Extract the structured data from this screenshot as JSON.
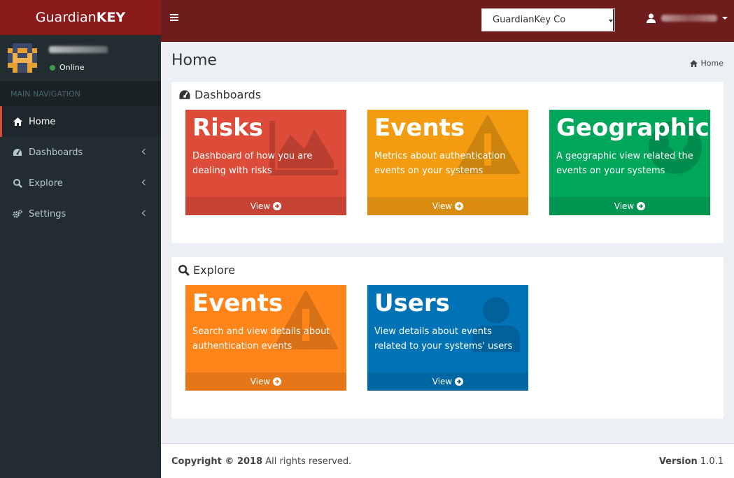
{
  "brand": {
    "light": "Guardian",
    "bold": "KEY"
  },
  "navbar": {
    "company": "GuardianKey Co"
  },
  "sidebar": {
    "status": "Online",
    "nav_header": "MAIN NAVIGATION",
    "items": [
      {
        "label": "Home",
        "icon": "home-icon"
      },
      {
        "label": "Dashboards",
        "icon": "dashboard-icon"
      },
      {
        "label": "Explore",
        "icon": "search-icon"
      },
      {
        "label": "Settings",
        "icon": "cogs-icon"
      }
    ]
  },
  "page": {
    "title": "Home",
    "breadcrumb": "Home"
  },
  "dashboards": {
    "title": "Dashboards",
    "tiles": [
      {
        "title": "Risks",
        "desc": "Dashboard of how you are dealing with risks",
        "footer": "View",
        "color": "#dd4b39",
        "icon": "area-chart-icon"
      },
      {
        "title": "Events",
        "desc": "Metrics about authentication events on your systems",
        "footer": "View",
        "color": "#f39c12",
        "icon": "warning-icon"
      },
      {
        "title": "Geographic",
        "desc": "A geographic view related the events on your systems",
        "footer": "View",
        "color": "#00a65a",
        "icon": "globe-icon"
      }
    ]
  },
  "explore": {
    "title": "Explore",
    "tiles": [
      {
        "title": "Events",
        "desc": "Search and view details about authentication events",
        "footer": "View",
        "color": "#ff851b",
        "icon": "warning-icon"
      },
      {
        "title": "Users",
        "desc": "View details about events related to your systems' users",
        "footer": "View",
        "color": "#0073b7",
        "icon": "user-icon"
      }
    ]
  },
  "footer": {
    "copyright": "Copyright © 2018",
    "rights": "All rights reserved.",
    "version_label": "Version",
    "version": "1.0.1"
  }
}
